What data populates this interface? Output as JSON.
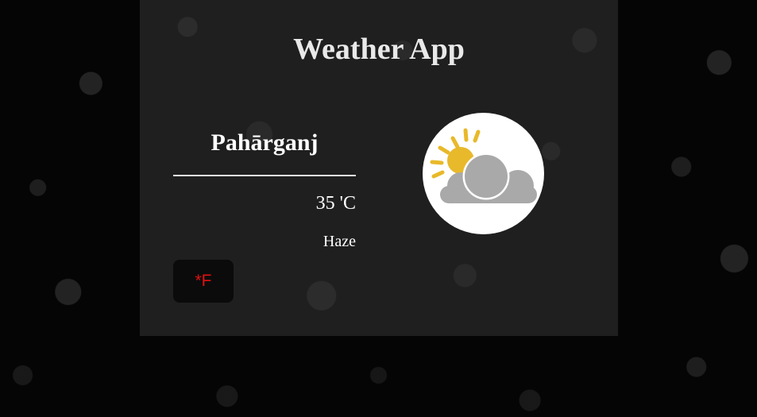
{
  "app": {
    "title": "Weather App"
  },
  "weather": {
    "city": "Pahārganj",
    "temperature": "35 'C",
    "description": "Haze",
    "icon": "partly-cloudy-day-icon"
  },
  "controls": {
    "unit_toggle_label": "*F"
  },
  "colors": {
    "background": "#000000",
    "card": "#222222",
    "text": "#ffffff",
    "unit_button_text": "#e01010",
    "sun": "#e8b92a",
    "cloud": "#a8a8a8"
  }
}
